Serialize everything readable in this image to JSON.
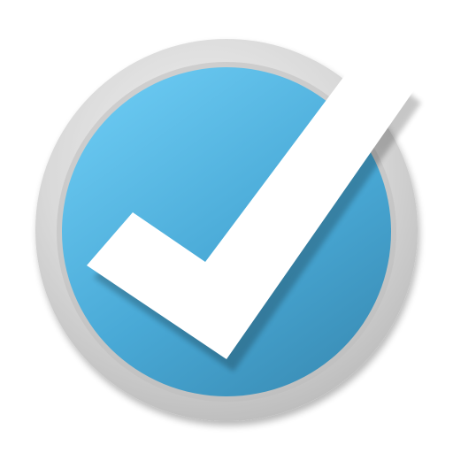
{
  "icon": {
    "name": "checkmark-badge",
    "glyph": "check-icon",
    "colors": {
      "background": "#ffffff",
      "ring_light": "#f4f4f4",
      "ring_mid": "#d9d9d9",
      "ring_dark": "#b9b9b9",
      "disc_light": "#67c6ef",
      "disc_mid": "#49a9d6",
      "disc_dark": "#3b8fb8",
      "check": "#ffffff",
      "shadow": "#000000"
    }
  }
}
